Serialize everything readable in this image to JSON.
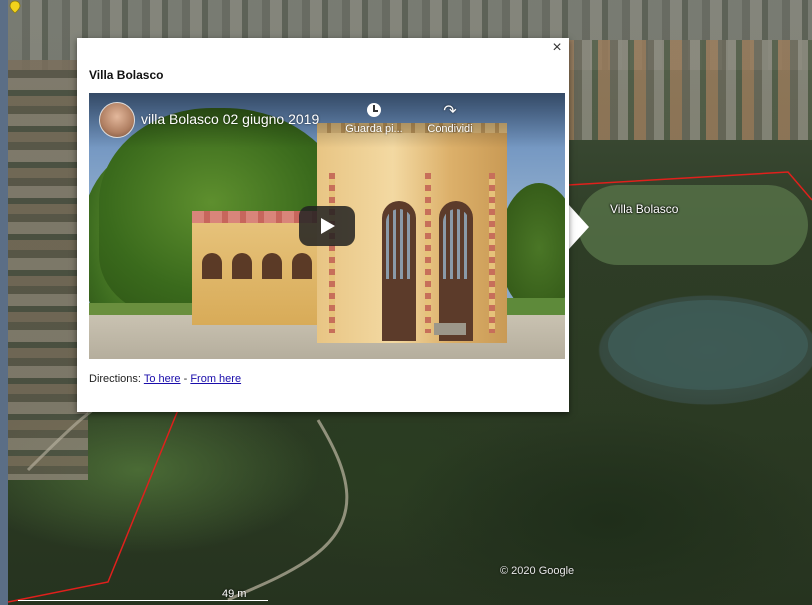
{
  "map": {
    "place_label": "Villa Bolasco",
    "copyright": "© 2020 Google",
    "scale_label": "49 m",
    "boundary_color": "#e0201c",
    "pin_color": "#f2d21b"
  },
  "info_window": {
    "title": "Villa Bolasco",
    "close_glyph": "×",
    "video": {
      "title": "villa Bolasco 02 giugno 2019",
      "watch_later_label": "Guarda pi...",
      "share_label": "Condividi"
    },
    "directions": {
      "prefix": "Directions:",
      "to_here": "To here",
      "separator": "-",
      "from_here": "From here"
    }
  }
}
